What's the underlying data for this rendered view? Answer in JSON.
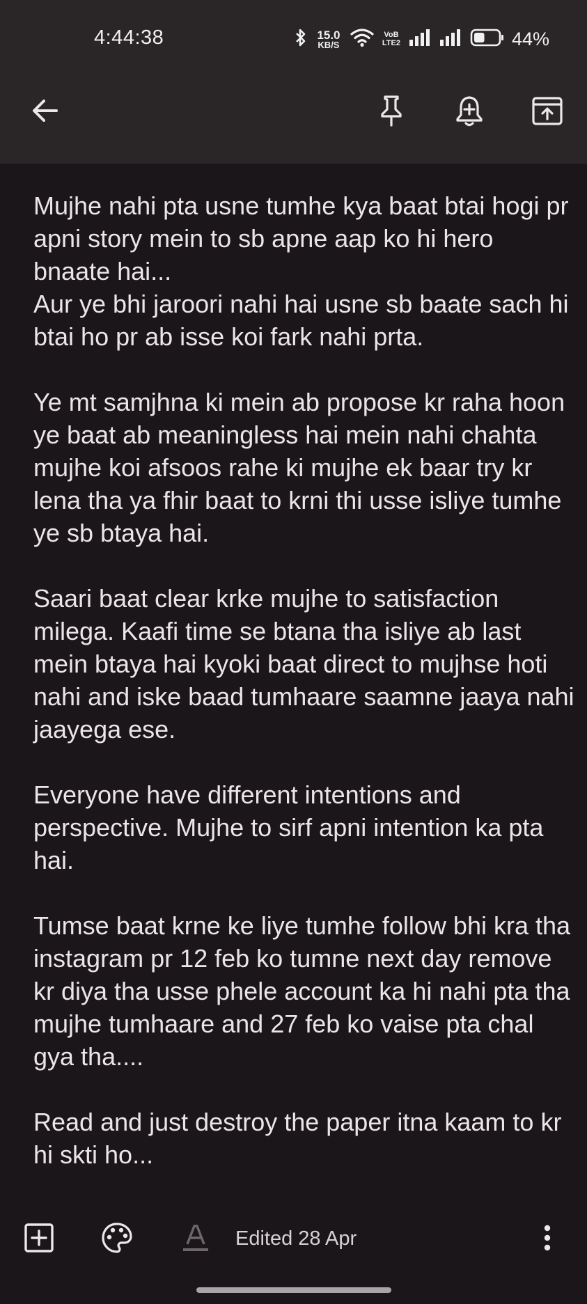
{
  "status_bar": {
    "time": "4:44:38",
    "net_speed_value": "15.0",
    "net_speed_unit": "KB/S",
    "volte_top": "VoB",
    "volte_bottom": "LTE2",
    "battery_percent": "44%",
    "battery_level": 0.44
  },
  "toolbar": {
    "back_icon": "arrow-back-icon",
    "pin_icon": "pin-icon",
    "reminder_icon": "bell-plus-icon",
    "archive_icon": "archive-icon"
  },
  "note": {
    "paragraphs": [
      "Mujhe nahi pta usne tumhe kya baat btai hogi pr apni story mein to sb apne aap ko hi hero bnaate hai...\nAur ye bhi jaroori nahi hai usne sb baate sach hi btai ho pr ab isse koi fark nahi prta.",
      "Ye mt samjhna ki mein ab propose kr raha hoon ye baat ab meaningless hai mein nahi chahta mujhe koi afsoos rahe ki mujhe ek baar try kr lena tha ya fhir baat to krni thi usse isliye tumhe ye sb btaya hai.",
      "Saari baat clear krke mujhe to satisfaction milega. Kaafi time se btana tha isliye ab last mein btaya hai kyoki baat direct to mujhse hoti nahi and iske baad tumhaare saamne jaaya nahi jaayega ese.",
      "Everyone have different intentions and perspective. Mujhe to sirf apni intention ka pta hai.",
      "Tumse baat krne ke liye tumhe follow bhi kra tha instagram pr 12 feb ko tumne next day remove kr diya tha usse phele account ka hi nahi pta tha mujhe tumhaare and 27 feb ko vaise pta chal gya tha....",
      "Read and just destroy the paper itna kaam to kr hi skti ho..."
    ]
  },
  "bottom_bar": {
    "edited_label": "Edited 28 Apr",
    "add_icon": "add-box-icon",
    "palette_icon": "palette-icon",
    "text_format_icon": "text-format-icon",
    "more_icon": "more-vert-icon"
  },
  "colors": {
    "background": "#1b1619",
    "topbar": "#2a2628",
    "text": "#ebe5e9"
  }
}
